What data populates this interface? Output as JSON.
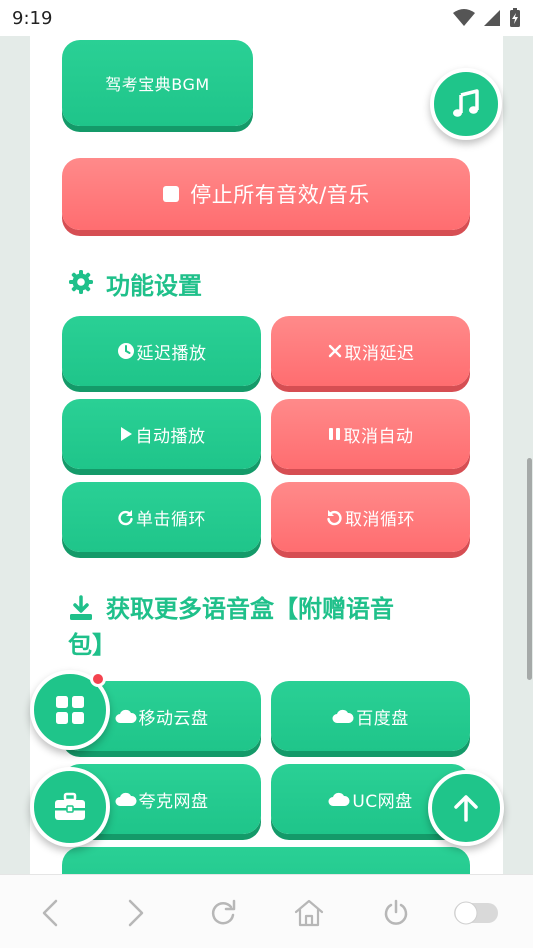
{
  "status": {
    "time": "9:19"
  },
  "buttons": {
    "bgm": "驾考宝典BGM",
    "stop_all": "停止所有音效/音乐"
  },
  "sections": {
    "settings_title": "功能设置",
    "download_title_line1": "获取更多语音盒【附赠语音",
    "download_title_line2": "包】"
  },
  "settings_buttons": [
    {
      "label": "延迟播放",
      "icon": "clock-icon"
    },
    {
      "label": "取消延迟",
      "icon": "x-icon"
    },
    {
      "label": "自动播放",
      "icon": "play-icon"
    },
    {
      "label": "取消自动",
      "icon": "pause-icon"
    },
    {
      "label": "单击循环",
      "icon": "redo-icon"
    },
    {
      "label": "取消循环",
      "icon": "undo-icon"
    }
  ],
  "download_buttons": [
    {
      "label": "移动云盘",
      "icon": "cloud-icon"
    },
    {
      "label": "百度盘",
      "icon": "cloud-icon"
    },
    {
      "label": "夸克网盘",
      "icon": "cloud-icon"
    },
    {
      "label": "UC网盘",
      "icon": "cloud-icon"
    }
  ],
  "colors": {
    "green": "#1fc58a",
    "red": "#ff6d70",
    "title_green": "#1fc08a",
    "badge_red": "#f4434f"
  }
}
